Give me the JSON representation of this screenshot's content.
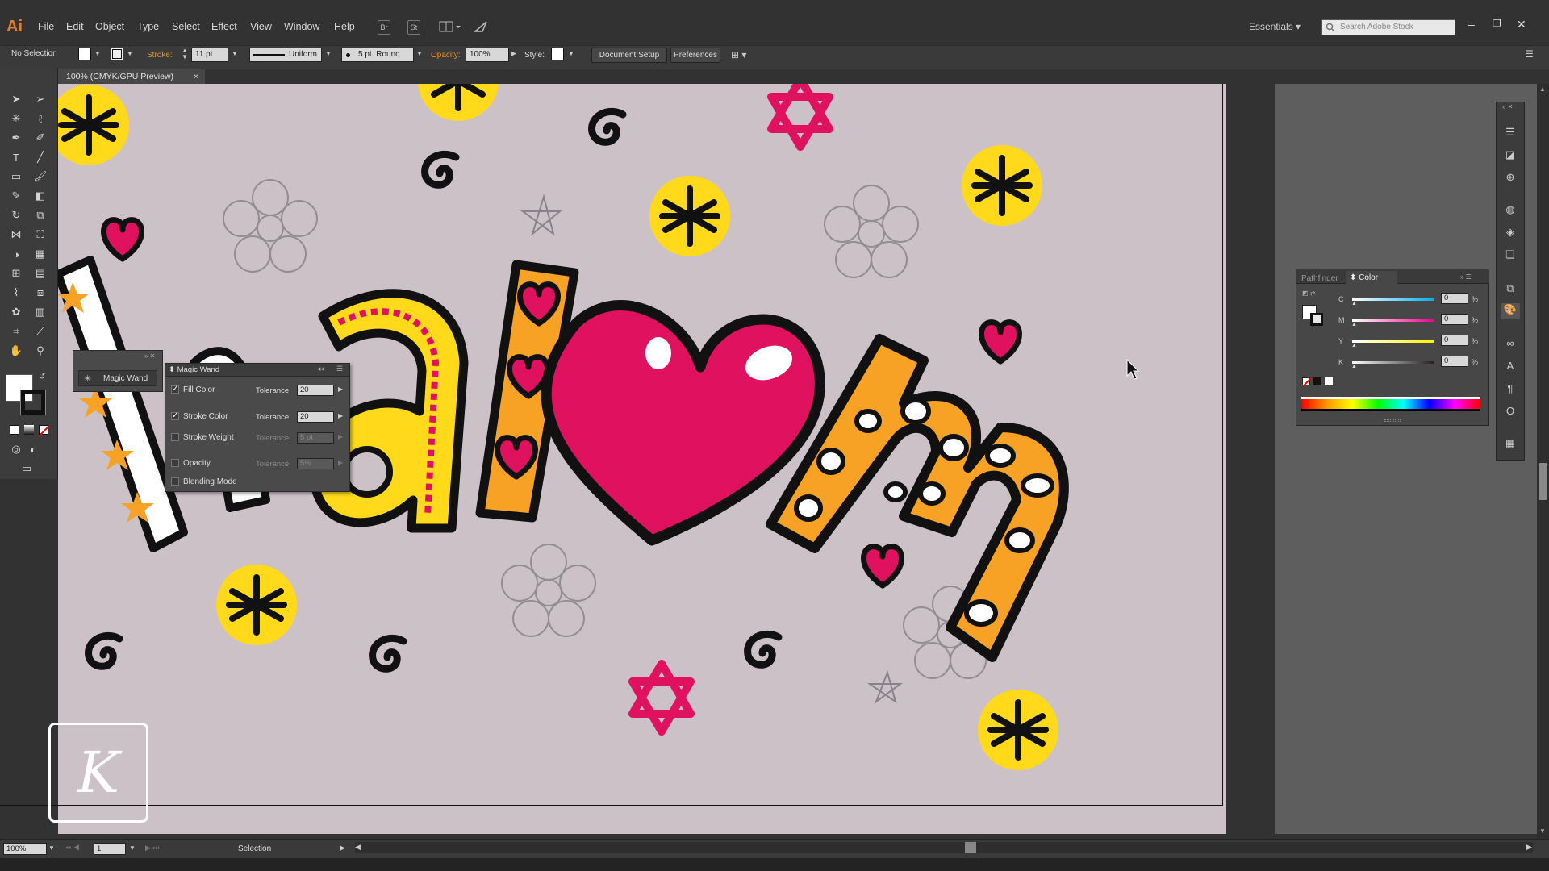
{
  "app": {
    "logo": "Ai",
    "menu": [
      "File",
      "Edit",
      "Object",
      "Type",
      "Select",
      "Effect",
      "View",
      "Window",
      "Help"
    ],
    "bar_buttons": [
      "Br",
      "St"
    ],
    "workspace": "Essentials",
    "stock_search_placeholder": "Search Adobe Stock"
  },
  "control_bar": {
    "selection_label": "No Selection",
    "stroke_label": "Stroke:",
    "stroke_value": "11 pt",
    "profile_value": "Uniform",
    "brush_value": "5 pt. Round",
    "opacity_label": "Opacity:",
    "opacity_value": "100%",
    "style_label": "Style:",
    "document_setup": "Document Setup",
    "preferences": "Preferences"
  },
  "document_tab": {
    "title": "100% (CMYK/GPU Preview)",
    "close": "×"
  },
  "magic_wand": {
    "tab_label": "Magic Wand",
    "panel_title": "Magic Wand",
    "rows": [
      {
        "label": "Fill Color",
        "checked": true,
        "tolerance_label": "Tolerance:",
        "value": "20",
        "enabled": true
      },
      {
        "label": "Stroke Color",
        "checked": true,
        "tolerance_label": "Tolerance:",
        "value": "20",
        "enabled": true
      },
      {
        "label": "Stroke Weight",
        "checked": false,
        "tolerance_label": "Tolerance:",
        "value": "5 pt",
        "enabled": false
      },
      {
        "label": "Opacity",
        "checked": false,
        "tolerance_label": "Tolerance:",
        "value": "5%",
        "enabled": false
      },
      {
        "label": "Blending Mode",
        "checked": false
      }
    ]
  },
  "color_panel": {
    "tabs": [
      "Pathfinder",
      "Color"
    ],
    "sliders": [
      {
        "label": "C",
        "value": "0",
        "unit": "%",
        "color": "#00aeef"
      },
      {
        "label": "M",
        "value": "0",
        "unit": "%",
        "color": "#ec008c"
      },
      {
        "label": "Y",
        "value": "0",
        "unit": "%",
        "color": "#fff200"
      },
      {
        "label": "K",
        "value": "0",
        "unit": "%",
        "color": "#231f20"
      }
    ]
  },
  "status_bar": {
    "zoom": "100%",
    "artboard": "1",
    "mode": "Selection"
  },
  "colors": {
    "pink": "#e0115f",
    "yellow": "#ffd91a",
    "orange": "#f7a224",
    "outline": "#111111",
    "paper": "#cdc1c8"
  },
  "watermark": "K"
}
